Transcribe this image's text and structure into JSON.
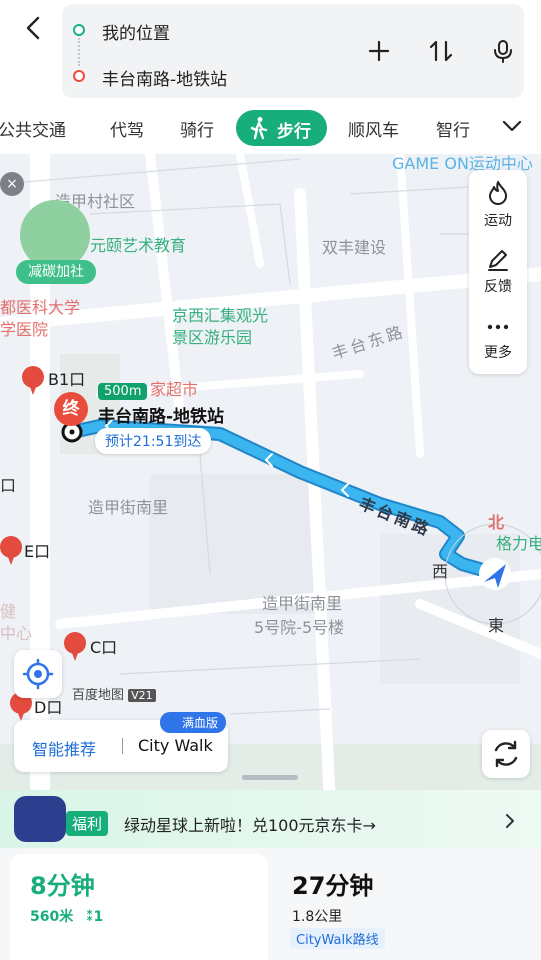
{
  "route": {
    "start": "我的位置",
    "end": "丰台南路-地铁站"
  },
  "tabs": [
    "公共交通",
    "代驾",
    "骑行",
    "步行",
    "顺风车",
    "智行"
  ],
  "map": {
    "labels": {
      "game": "GAME ON运动中心",
      "village": "造甲村社区",
      "art": "元颐艺术教育",
      "shuangfeng": "双丰建设",
      "hospital1": "都医科大学",
      "hospital2": "学医院",
      "park1": "京西汇集观光",
      "park2": "景区游乐园",
      "road_east": "丰台东路",
      "supermarket": "家超市",
      "nanli": "造甲街南里",
      "block1": "造甲街南里",
      "block2": "5号院-5号楼",
      "geli": "格力电",
      "north": "北",
      "kou_left": "口",
      "jian": "健",
      "zhongxin": "中心",
      "xi": "西",
      "dong": "東",
      "carbon": "减碳加社"
    },
    "exits": [
      "B1口",
      "E口",
      "C口",
      "D口"
    ],
    "destination_badge": "终",
    "distance": "500m",
    "destination_name": "丰台南路-地铁站",
    "eta": "预计21:51到达",
    "road_label": "丰台南路",
    "brand": "百度地图",
    "brand_version": "V21"
  },
  "side_panel": [
    "运动",
    "反馈",
    "更多"
  ],
  "mode_switch": {
    "smart": "智能推荐",
    "citywalk": "City Walk",
    "tag": "满血版"
  },
  "promo": {
    "tag": "福利",
    "text": "绿动星球上新啦！兑100元京东卡→"
  },
  "plans": [
    {
      "time": "8分钟",
      "distance": "560米",
      "lights": "1"
    },
    {
      "time": "27分钟",
      "distance": "1.8公里",
      "tag": "CityWalk路线"
    }
  ],
  "colors": {
    "accent_green": "#18ae7c",
    "route_blue": "#2fa8e8",
    "red": "#ea4c3c"
  }
}
